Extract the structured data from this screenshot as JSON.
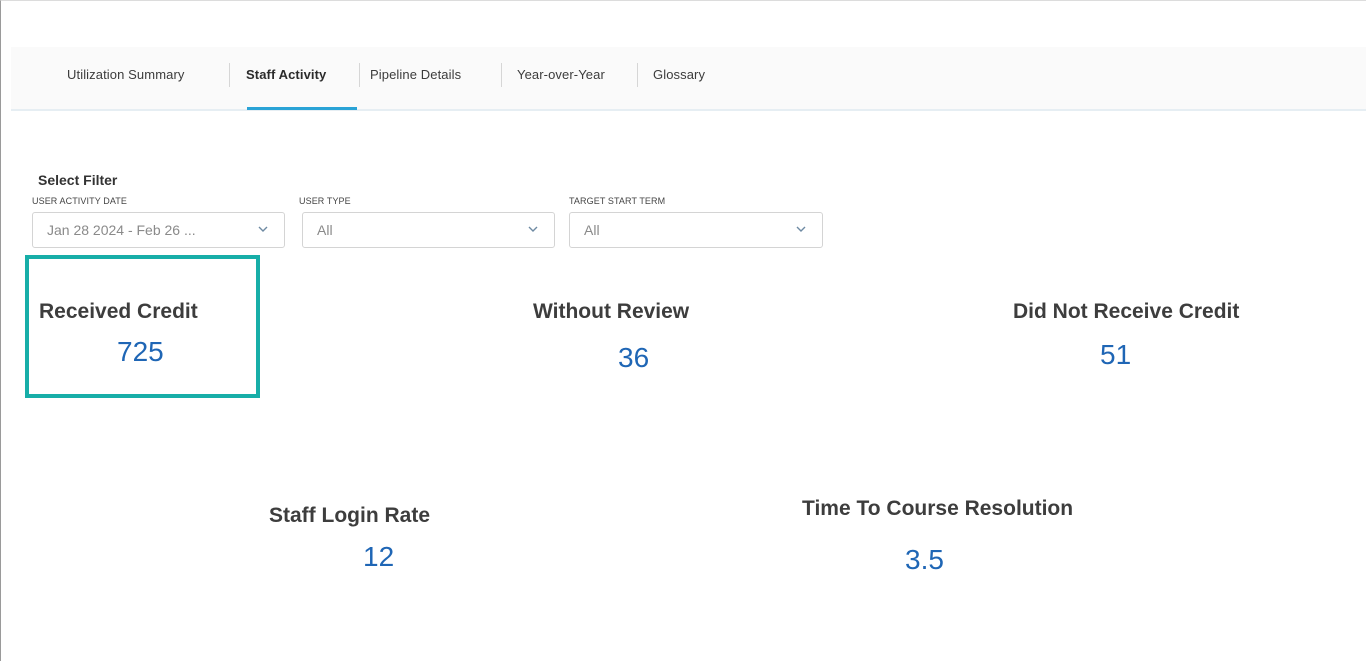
{
  "tabs": [
    {
      "label": "Utilization Summary",
      "active": false
    },
    {
      "label": "Staff Activity",
      "active": true
    },
    {
      "label": "Pipeline Details",
      "active": false
    },
    {
      "label": "Year-over-Year",
      "active": false
    },
    {
      "label": "Glossary",
      "active": false
    }
  ],
  "filters": {
    "title": "Select Filter",
    "user_activity_date": {
      "label": "USER ACTIVITY DATE",
      "value": "Jan 28 2024 - Feb 26 ..."
    },
    "user_type": {
      "label": "USER TYPE",
      "value": "All"
    },
    "target_start_term": {
      "label": "TARGET START TERM",
      "value": "All"
    }
  },
  "kpis": {
    "received_credit": {
      "label": "Received Credit",
      "value": "725"
    },
    "without_review": {
      "label": "Without Review",
      "value": "36"
    },
    "did_not_receive_credit": {
      "label": "Did Not Receive Credit",
      "value": "51"
    },
    "staff_login_rate": {
      "label": "Staff Login Rate",
      "value": "12"
    },
    "time_to_course_resolution": {
      "label": "Time To Course Resolution",
      "value": "3.5"
    }
  },
  "colors": {
    "accent": "#2aa3d6",
    "highlight": "#17aea8",
    "kpi_value": "#1f66b5"
  }
}
